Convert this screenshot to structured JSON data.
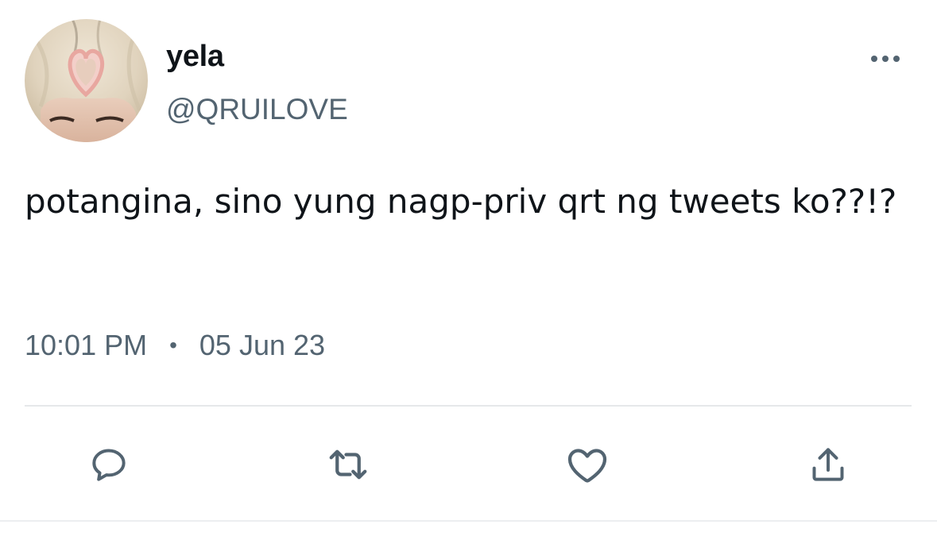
{
  "tweet": {
    "author": {
      "display_name": "yela",
      "handle": "@QRUILOVE"
    },
    "text": "potangina, sino yung nagp-priv qrt ng tweets ko??!?",
    "time": "10:01 PM",
    "separator": "•",
    "date": "05 Jun 23"
  },
  "icons": {
    "more": "more-horizontal-icon",
    "reply": "reply-icon",
    "retweet": "retweet-icon",
    "like": "heart-icon",
    "share": "share-icon"
  },
  "colors": {
    "text_primary": "#0f1419",
    "text_secondary": "#536471",
    "icon": "#536471",
    "divider": "#e6e8ea",
    "background": "#ffffff"
  }
}
